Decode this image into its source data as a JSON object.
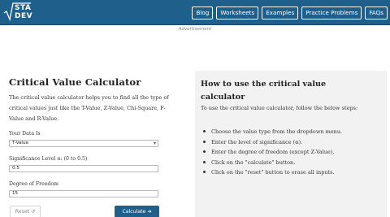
{
  "header": {
    "logo_line1": "STA",
    "logo_line2": "DEV",
    "nav": [
      {
        "label": "Blog"
      },
      {
        "label": "Worksheets"
      },
      {
        "label": "Examples"
      },
      {
        "label": "Practice Problems"
      },
      {
        "label": "FAQs"
      }
    ],
    "colors": {
      "bar": "#1f5f8b"
    }
  },
  "ad_label": "Advertisement",
  "calculator": {
    "title": "Critical Value Calculator",
    "intro": "The critical value calculator helps you to find all the type of critical values just like the T-Value, Z-Value, Chi-Square, F-Value and R-Value.",
    "data_label": "Your Data Is",
    "data_value": "T-Value",
    "significance_label": "Significance Level α: (0 to 0.5)",
    "significance_value": "0.5",
    "dof_label": "Degree of Freedom",
    "dof_value": "15",
    "reset_label": "Reset",
    "calculate_label": "Calculate"
  },
  "howto": {
    "title": "How to use the critical value calculator",
    "text": "To use the critical value calculator, follow the below steps:",
    "steps": [
      "Choose the value type from the dropdown menu.",
      "Enter the level of significance (α).",
      "Enter the degree of freedom (except Z-Value).",
      "Click on the \"calculate\" button.",
      "Click on the \"reset\" button to erase all inputs."
    ]
  }
}
